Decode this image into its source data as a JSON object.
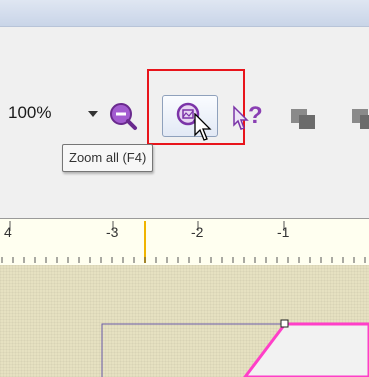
{
  "toolbar": {
    "zoom_value": "100%",
    "zoom_tooltip": "Zoom all (F4)"
  },
  "ruler": {
    "labels": [
      "4",
      "-3",
      "-2",
      "-1"
    ]
  },
  "icons": {
    "zoom_out": "zoom-out-icon",
    "zoom_all": "zoom-all-icon",
    "help": "help-pointer-icon",
    "copy": "copy-icon",
    "cursor": "mouse-cursor-icon"
  },
  "colors": {
    "highlight": "#e8141b",
    "icon_purple": "#8a3fb3",
    "canvas": "#e6e1c1",
    "shape_outline": "#ff3fc8"
  }
}
